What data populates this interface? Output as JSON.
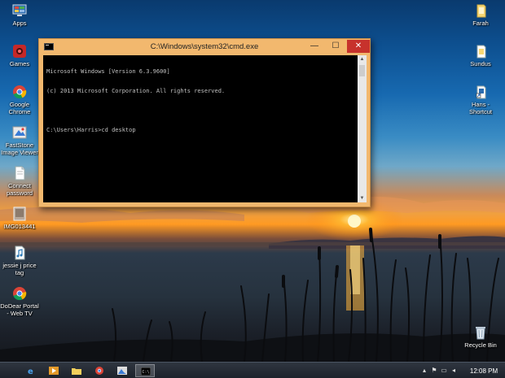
{
  "desktop": {
    "left_icons": [
      {
        "label": "Apps",
        "icon": "apps-icon"
      },
      {
        "label": "Games",
        "icon": "games-icon"
      },
      {
        "label": "Google\nChrome",
        "icon": "chrome-icon"
      },
      {
        "label": "FastStone\nImage Viewer",
        "icon": "faststone-icon"
      },
      {
        "label": "Connect\npassword",
        "icon": "document-icon"
      },
      {
        "label": "IMG013441",
        "icon": "image-file-icon"
      },
      {
        "label": "jessie j price\ntag",
        "icon": "audio-file-icon"
      },
      {
        "label": "DoDear Portal\n- Web TV",
        "icon": "chrome-icon"
      }
    ],
    "right_icons": [
      {
        "label": "Farah",
        "icon": "folder-icon"
      },
      {
        "label": "Sundus",
        "icon": "folder-icon"
      },
      {
        "label": "Hans -\nShortcut",
        "icon": "shortcut-icon"
      },
      {
        "label": "Recycle Bin",
        "icon": "recycle-bin-icon"
      }
    ]
  },
  "cmd_window": {
    "title": "C:\\Windows\\system32\\cmd.exe",
    "lines": [
      "Microsoft Windows [Version 6.3.9600]",
      "(c) 2013 Microsoft Corporation. All rights reserved.",
      "",
      "C:\\Users\\Harris>cd desktop"
    ],
    "minimize_glyph": "—",
    "maximize_glyph": "☐",
    "close_glyph": "✕"
  },
  "taskbar": {
    "clock": "12:08 PM",
    "items": [
      {
        "icon": "ie-icon",
        "active": false
      },
      {
        "icon": "media-player-icon",
        "active": false
      },
      {
        "icon": "file-explorer-icon",
        "active": false
      },
      {
        "icon": "chrome-icon",
        "active": false
      },
      {
        "icon": "faststone-icon",
        "active": false
      },
      {
        "icon": "cmd-icon",
        "active": true
      }
    ]
  },
  "colors": {
    "titlebar": "#f2b86e",
    "close_button": "#c7322c",
    "console_bg": "#000000",
    "console_text": "#c0c0c0"
  }
}
